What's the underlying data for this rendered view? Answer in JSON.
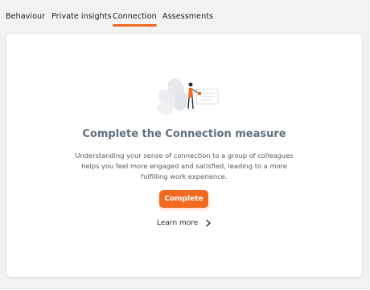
{
  "tabs": [
    {
      "label": "Behaviour",
      "active": false
    },
    {
      "label": "Private insights",
      "active": false
    },
    {
      "label": "Connection",
      "active": true
    },
    {
      "label": "Assessments",
      "active": false
    }
  ],
  "main": {
    "title": "Complete the Connection measure",
    "description": "Understanding your sense of connection to a group of colleagues helps you feel more engaged and satisfied, leading to a more fulfilling work experience.",
    "complete_button": "Complete",
    "learn_more": "Learn more"
  },
  "icons": {
    "illustration": "person-presenting-illustration",
    "learn_more_chevron": "chevron-right-icon"
  },
  "colors": {
    "accent": "#f26a21",
    "title": "#5f6f7e",
    "background": "#f2f2f1",
    "card": "#ffffff"
  }
}
